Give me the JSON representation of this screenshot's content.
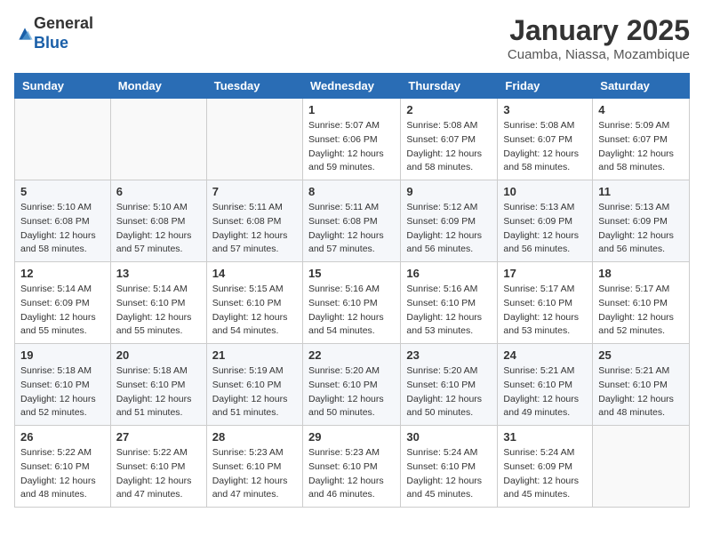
{
  "header": {
    "logo_general": "General",
    "logo_blue": "Blue",
    "month_title": "January 2025",
    "subtitle": "Cuamba, Niassa, Mozambique"
  },
  "weekdays": [
    "Sunday",
    "Monday",
    "Tuesday",
    "Wednesday",
    "Thursday",
    "Friday",
    "Saturday"
  ],
  "weeks": [
    [
      {
        "day": "",
        "sunrise": "",
        "sunset": "",
        "daylight": ""
      },
      {
        "day": "",
        "sunrise": "",
        "sunset": "",
        "daylight": ""
      },
      {
        "day": "",
        "sunrise": "",
        "sunset": "",
        "daylight": ""
      },
      {
        "day": "1",
        "sunrise": "Sunrise: 5:07 AM",
        "sunset": "Sunset: 6:06 PM",
        "daylight": "Daylight: 12 hours and 59 minutes."
      },
      {
        "day": "2",
        "sunrise": "Sunrise: 5:08 AM",
        "sunset": "Sunset: 6:07 PM",
        "daylight": "Daylight: 12 hours and 58 minutes."
      },
      {
        "day": "3",
        "sunrise": "Sunrise: 5:08 AM",
        "sunset": "Sunset: 6:07 PM",
        "daylight": "Daylight: 12 hours and 58 minutes."
      },
      {
        "day": "4",
        "sunrise": "Sunrise: 5:09 AM",
        "sunset": "Sunset: 6:07 PM",
        "daylight": "Daylight: 12 hours and 58 minutes."
      }
    ],
    [
      {
        "day": "5",
        "sunrise": "Sunrise: 5:10 AM",
        "sunset": "Sunset: 6:08 PM",
        "daylight": "Daylight: 12 hours and 58 minutes."
      },
      {
        "day": "6",
        "sunrise": "Sunrise: 5:10 AM",
        "sunset": "Sunset: 6:08 PM",
        "daylight": "Daylight: 12 hours and 57 minutes."
      },
      {
        "day": "7",
        "sunrise": "Sunrise: 5:11 AM",
        "sunset": "Sunset: 6:08 PM",
        "daylight": "Daylight: 12 hours and 57 minutes."
      },
      {
        "day": "8",
        "sunrise": "Sunrise: 5:11 AM",
        "sunset": "Sunset: 6:08 PM",
        "daylight": "Daylight: 12 hours and 57 minutes."
      },
      {
        "day": "9",
        "sunrise": "Sunrise: 5:12 AM",
        "sunset": "Sunset: 6:09 PM",
        "daylight": "Daylight: 12 hours and 56 minutes."
      },
      {
        "day": "10",
        "sunrise": "Sunrise: 5:13 AM",
        "sunset": "Sunset: 6:09 PM",
        "daylight": "Daylight: 12 hours and 56 minutes."
      },
      {
        "day": "11",
        "sunrise": "Sunrise: 5:13 AM",
        "sunset": "Sunset: 6:09 PM",
        "daylight": "Daylight: 12 hours and 56 minutes."
      }
    ],
    [
      {
        "day": "12",
        "sunrise": "Sunrise: 5:14 AM",
        "sunset": "Sunset: 6:09 PM",
        "daylight": "Daylight: 12 hours and 55 minutes."
      },
      {
        "day": "13",
        "sunrise": "Sunrise: 5:14 AM",
        "sunset": "Sunset: 6:10 PM",
        "daylight": "Daylight: 12 hours and 55 minutes."
      },
      {
        "day": "14",
        "sunrise": "Sunrise: 5:15 AM",
        "sunset": "Sunset: 6:10 PM",
        "daylight": "Daylight: 12 hours and 54 minutes."
      },
      {
        "day": "15",
        "sunrise": "Sunrise: 5:16 AM",
        "sunset": "Sunset: 6:10 PM",
        "daylight": "Daylight: 12 hours and 54 minutes."
      },
      {
        "day": "16",
        "sunrise": "Sunrise: 5:16 AM",
        "sunset": "Sunset: 6:10 PM",
        "daylight": "Daylight: 12 hours and 53 minutes."
      },
      {
        "day": "17",
        "sunrise": "Sunrise: 5:17 AM",
        "sunset": "Sunset: 6:10 PM",
        "daylight": "Daylight: 12 hours and 53 minutes."
      },
      {
        "day": "18",
        "sunrise": "Sunrise: 5:17 AM",
        "sunset": "Sunset: 6:10 PM",
        "daylight": "Daylight: 12 hours and 52 minutes."
      }
    ],
    [
      {
        "day": "19",
        "sunrise": "Sunrise: 5:18 AM",
        "sunset": "Sunset: 6:10 PM",
        "daylight": "Daylight: 12 hours and 52 minutes."
      },
      {
        "day": "20",
        "sunrise": "Sunrise: 5:18 AM",
        "sunset": "Sunset: 6:10 PM",
        "daylight": "Daylight: 12 hours and 51 minutes."
      },
      {
        "day": "21",
        "sunrise": "Sunrise: 5:19 AM",
        "sunset": "Sunset: 6:10 PM",
        "daylight": "Daylight: 12 hours and 51 minutes."
      },
      {
        "day": "22",
        "sunrise": "Sunrise: 5:20 AM",
        "sunset": "Sunset: 6:10 PM",
        "daylight": "Daylight: 12 hours and 50 minutes."
      },
      {
        "day": "23",
        "sunrise": "Sunrise: 5:20 AM",
        "sunset": "Sunset: 6:10 PM",
        "daylight": "Daylight: 12 hours and 50 minutes."
      },
      {
        "day": "24",
        "sunrise": "Sunrise: 5:21 AM",
        "sunset": "Sunset: 6:10 PM",
        "daylight": "Daylight: 12 hours and 49 minutes."
      },
      {
        "day": "25",
        "sunrise": "Sunrise: 5:21 AM",
        "sunset": "Sunset: 6:10 PM",
        "daylight": "Daylight: 12 hours and 48 minutes."
      }
    ],
    [
      {
        "day": "26",
        "sunrise": "Sunrise: 5:22 AM",
        "sunset": "Sunset: 6:10 PM",
        "daylight": "Daylight: 12 hours and 48 minutes."
      },
      {
        "day": "27",
        "sunrise": "Sunrise: 5:22 AM",
        "sunset": "Sunset: 6:10 PM",
        "daylight": "Daylight: 12 hours and 47 minutes."
      },
      {
        "day": "28",
        "sunrise": "Sunrise: 5:23 AM",
        "sunset": "Sunset: 6:10 PM",
        "daylight": "Daylight: 12 hours and 47 minutes."
      },
      {
        "day": "29",
        "sunrise": "Sunrise: 5:23 AM",
        "sunset": "Sunset: 6:10 PM",
        "daylight": "Daylight: 12 hours and 46 minutes."
      },
      {
        "day": "30",
        "sunrise": "Sunrise: 5:24 AM",
        "sunset": "Sunset: 6:10 PM",
        "daylight": "Daylight: 12 hours and 45 minutes."
      },
      {
        "day": "31",
        "sunrise": "Sunrise: 5:24 AM",
        "sunset": "Sunset: 6:09 PM",
        "daylight": "Daylight: 12 hours and 45 minutes."
      },
      {
        "day": "",
        "sunrise": "",
        "sunset": "",
        "daylight": ""
      }
    ]
  ]
}
